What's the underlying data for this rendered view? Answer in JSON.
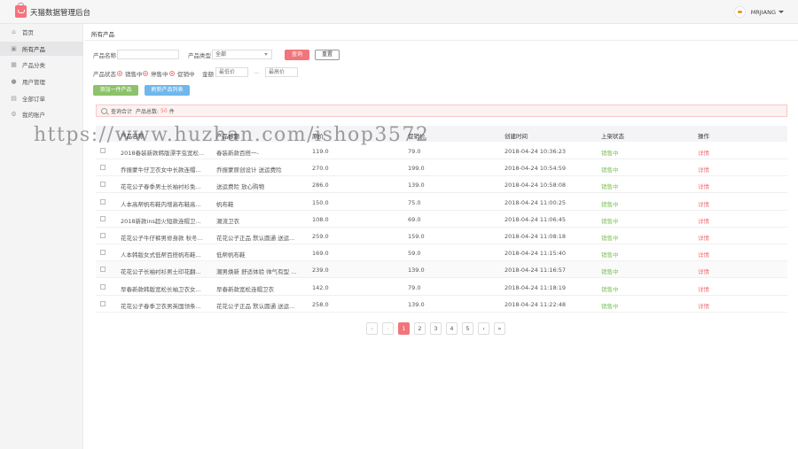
{
  "header": {
    "app_title": "天猫数据管理后台",
    "username": "MRJIANG"
  },
  "sidebar": {
    "items": [
      {
        "label": "首页",
        "icon": "home-icon"
      },
      {
        "label": "所有产品",
        "icon": "grid-icon"
      },
      {
        "label": "产品分类",
        "icon": "category-icon"
      },
      {
        "label": "用户管理",
        "icon": "user-icon"
      },
      {
        "label": "全部订单",
        "icon": "order-icon"
      },
      {
        "label": "我的账户",
        "icon": "gear-icon"
      }
    ]
  },
  "page": {
    "title": "所有产品"
  },
  "filters": {
    "name_label": "产品名称",
    "name_value": "",
    "type_label": "产品类型",
    "type_selected": "全部",
    "query_label": "查询",
    "reset_label": "重置",
    "status_label": "产品状态",
    "status_options": [
      "销售中",
      "停售中",
      "促销中"
    ],
    "amount_label": "金额",
    "min_placeholder": "最低价",
    "dash": "—",
    "max_placeholder": "最高价"
  },
  "actions": {
    "add_label": "添加一件产品",
    "refresh_label": "刷新产品列表"
  },
  "summary": {
    "prefix": "查询合计",
    "middle": "产品总数:",
    "count": "50",
    "unit": "件"
  },
  "table": {
    "headers": [
      "产品名称",
      "产品标题",
      "原价",
      "促销价",
      "创建时间",
      "上架状态",
      "操作"
    ],
    "rows": [
      {
        "name": "2018春装新款韩版漂字虫宽松...",
        "title": "春装新款百搭一-",
        "price": "119.0",
        "promo": "79.0",
        "created": "2018-04-24 10:36:23",
        "status": "销售中",
        "action": "详情"
      },
      {
        "name": "乔振蒙牛仔卫衣女中长款连帽...",
        "title": "乔振蒙原创设计 送运费险",
        "price": "270.0",
        "promo": "199.0",
        "created": "2018-04-24 10:54:59",
        "status": "销售中",
        "action": "详情"
      },
      {
        "name": "花花公子春季男士长袖衬衫免...",
        "title": "送运费险 放心购物",
        "price": "286.0",
        "promo": "139.0",
        "created": "2018-04-24 10:58:08",
        "status": "销售中",
        "action": "详情"
      },
      {
        "name": "人本高帮帆布鞋内增高布鞋高...",
        "title": "帆布鞋",
        "price": "150.0",
        "promo": "75.0",
        "created": "2018-04-24 11:00:25",
        "status": "销售中",
        "action": "详情"
      },
      {
        "name": "2018新款ins超火短款连帽卫...",
        "title": "潮流卫衣",
        "price": "108.0",
        "promo": "69.0",
        "created": "2018-04-24 11:06:45",
        "status": "销售中",
        "action": "详情"
      },
      {
        "name": "花花公子牛仔裤男修身款 秋冬...",
        "title": "花花公子正品 默认圆通 送运...",
        "price": "259.0",
        "promo": "159.0",
        "created": "2018-04-24 11:08:18",
        "status": "销售中",
        "action": "详情"
      },
      {
        "name": "人本韩版女式低帮百搭帆布鞋...",
        "title": "低帮帆布鞋",
        "price": "169.0",
        "promo": "59.0",
        "created": "2018-04-24 11:15:40",
        "status": "销售中",
        "action": "详情"
      },
      {
        "name": "花花公子长袖衬衫男士印花翻...",
        "title": "潮男焕新 舒适体验 帅气有型 ...",
        "price": "239.0",
        "promo": "139.0",
        "created": "2018-04-24 11:16:57",
        "status": "销售中",
        "action": "详情"
      },
      {
        "name": "早春新款韩版宽松长袖卫衣女...",
        "title": "早春新款宽松连帽卫衣",
        "price": "142.0",
        "promo": "79.0",
        "created": "2018-04-24 11:18:19",
        "status": "销售中",
        "action": "详情"
      },
      {
        "name": "花花公子春季卫衣男英国领条...",
        "title": "花花公子正品 默认圆通 送运...",
        "price": "258.0",
        "promo": "139.0",
        "created": "2018-04-24 11:22:48",
        "status": "销售中",
        "action": "详情"
      }
    ]
  },
  "pagination": {
    "first": "«",
    "prev": "‹",
    "pages": [
      "1",
      "2",
      "3",
      "4",
      "5"
    ],
    "next": "›",
    "last": "»",
    "current": "1"
  },
  "watermark": "https://www.huzhan.com/ishop3572",
  "colors": {
    "accent": "#f0767c",
    "status_green": "#7dc05a",
    "add_button": "#8cc26a",
    "refresh_button": "#6fb7ec"
  }
}
